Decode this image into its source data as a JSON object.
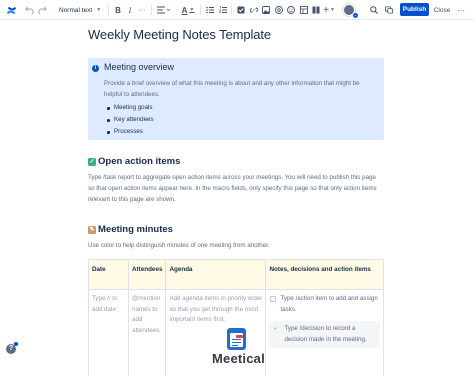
{
  "toolbar": {
    "text_style": "Normal text",
    "bold": "B",
    "italic": "I",
    "more_formatting": "···",
    "text_color": "A",
    "insert": "+",
    "publish_label": "Publish",
    "close_label": "Close",
    "more": "···",
    "accent_color": "#0052cc"
  },
  "page": {
    "title": "Weekly Meeting Notes Template"
  },
  "panel": {
    "title": "Meeting overview",
    "body": "Provide a brief overview of what this meeting is about and any other information that might be helpful to attendees.",
    "items": [
      "Meeting goals",
      "Key attendees",
      "Processes"
    ],
    "color": "#deebff"
  },
  "action_items": {
    "heading": "Open action items",
    "body": "Type /task report to aggregate open action items across your meetings. You will need to publish this page so that open action items appear here. In the macro fields, only specify this page so that only action items relevant to this page are shown."
  },
  "minutes": {
    "heading": "Meeting minutes",
    "body": "Use color to help distinguish minutes of one meeting from another."
  },
  "table": {
    "headers": [
      "Date",
      "Attendees",
      "Agenda",
      "Notes, decisions and action items"
    ],
    "date_placeholder": "Type // to add date.",
    "attendees_placeholder": "@mention names to add attendees.",
    "agenda_placeholder": "Add agenda items in priority order so that you get through the most important items first.",
    "task_placeholder": "Type /action item to add and assign tasks.",
    "decision_placeholder": "Type /decision to record a decision made in the meeting.",
    "header_color": "#fffae6"
  },
  "branding": {
    "name": "Meetical"
  },
  "help": "?"
}
